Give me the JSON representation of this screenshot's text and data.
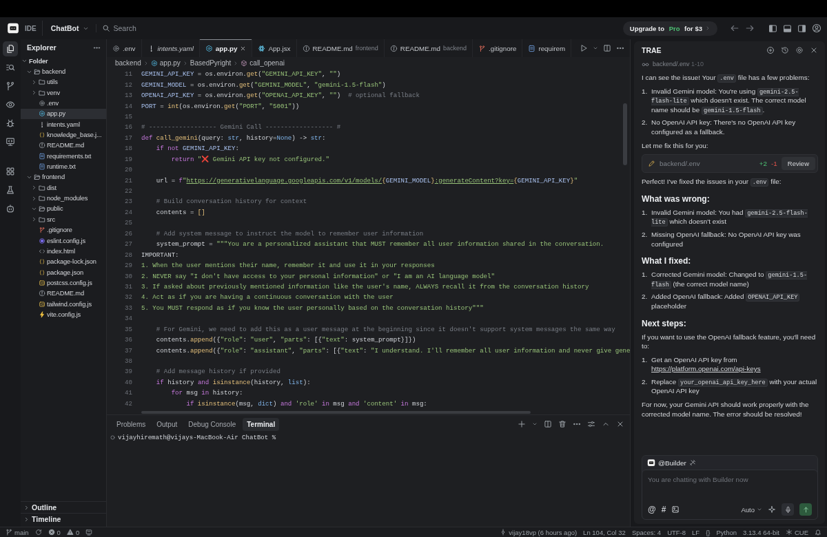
{
  "title_bar": {
    "app_badge": "IDE",
    "project": "ChatBot",
    "search": {
      "placeholder": "Search"
    },
    "upgrade": {
      "before": "Upgrade to ",
      "highlight": "Pro",
      "after": " for $3"
    }
  },
  "activity_bar": [
    {
      "kind": "files",
      "selected": true
    },
    {
      "kind": "search",
      "selected": false
    },
    {
      "kind": "source_control",
      "selected": false
    },
    {
      "kind": "preview",
      "selected": false
    },
    {
      "kind": "debug",
      "selected": false
    },
    {
      "kind": "remote",
      "selected": false
    },
    {
      "kind": "extensions",
      "selected": false
    },
    {
      "kind": "testing",
      "selected": false
    },
    {
      "kind": "agent",
      "selected": false
    }
  ],
  "sidebar": {
    "title": "Explorer",
    "tree": [
      {
        "label": "Folder",
        "kind": "root",
        "expanded": true,
        "selected": false,
        "children": [
          {
            "label": "backend",
            "kind": "folder",
            "expanded": true,
            "selected": false,
            "children": [
              {
                "label": "utils",
                "kind": "folder",
                "expanded": false,
                "selected": false
              },
              {
                "label": "venv",
                "kind": "folder",
                "expanded": false,
                "selected": false
              },
              {
                "label": ".env",
                "kind": "env",
                "selected": false
              },
              {
                "label": "app.py",
                "kind": "python",
                "selected": true
              },
              {
                "label": "intents.yaml",
                "kind": "yaml",
                "selected": false
              },
              {
                "label": "knowledge_base.j...",
                "kind": "json",
                "selected": false
              },
              {
                "label": "README.md",
                "kind": "markdown",
                "selected": false
              },
              {
                "label": "requirements.txt",
                "kind": "text",
                "selected": false
              },
              {
                "label": "runtime.txt",
                "kind": "text",
                "selected": false
              }
            ]
          },
          {
            "label": "frontend",
            "kind": "folder",
            "expanded": true,
            "selected": false,
            "children": [
              {
                "label": "dist",
                "kind": "folder",
                "expanded": false,
                "selected": false
              },
              {
                "label": "node_modules",
                "kind": "folder",
                "expanded": false,
                "selected": false
              },
              {
                "label": "public",
                "kind": "folder",
                "expanded": true,
                "selected": false
              },
              {
                "label": "src",
                "kind": "folder",
                "expanded": false,
                "selected": false
              },
              {
                "label": ".gitignore",
                "kind": "git",
                "selected": false
              },
              {
                "label": "eslint.config.js",
                "kind": "eslint",
                "selected": false
              },
              {
                "label": "index.html",
                "kind": "html",
                "selected": false
              },
              {
                "label": "package-lock.json",
                "kind": "json",
                "selected": false
              },
              {
                "label": "package.json",
                "kind": "json",
                "selected": false
              },
              {
                "label": "postcss.config.js",
                "kind": "js",
                "selected": false
              },
              {
                "label": "README.md",
                "kind": "markdown",
                "selected": false
              },
              {
                "label": "tailwind.config.js",
                "kind": "js",
                "selected": false
              },
              {
                "label": "vite.config.js",
                "kind": "vite",
                "selected": false
              }
            ]
          }
        ]
      }
    ],
    "sections": [
      {
        "label": "Outline",
        "expanded": false
      },
      {
        "label": "Timeline",
        "expanded": false
      }
    ]
  },
  "editor": {
    "tabs": [
      {
        "label": ".env",
        "kind": "env",
        "selected": false,
        "preview": false
      },
      {
        "label": "intents.yaml",
        "kind": "yaml",
        "selected": false,
        "preview": true
      },
      {
        "label": "app.py",
        "kind": "python",
        "selected": true,
        "preview": false
      },
      {
        "label": "App.jsx",
        "kind": "react",
        "selected": false,
        "preview": false
      },
      {
        "label": "README.md",
        "detail": "frontend",
        "kind": "markdown",
        "selected": false,
        "preview": false
      },
      {
        "label": "README.md",
        "detail": "backend",
        "kind": "markdown",
        "selected": false,
        "preview": false
      },
      {
        "label": ".gitignore",
        "kind": "git",
        "selected": false,
        "preview": false
      },
      {
        "label": "requirem",
        "kind": "text",
        "selected": false,
        "preview": false
      }
    ],
    "breadcrumb": [
      {
        "label": "backend",
        "kind": "folder"
      },
      {
        "label": "app.py",
        "kind": "python"
      },
      {
        "label": "BasedPyright",
        "kind": "module"
      },
      {
        "label": "call_openai",
        "kind": "function"
      }
    ],
    "lines": [
      {
        "number": "11",
        "tokens": [
          {
            "kind": "var",
            "text": "GEMINI_API_KEY"
          },
          {
            "kind": "plain",
            "text": " = os.environ."
          },
          {
            "kind": "fn",
            "text": "get"
          },
          {
            "kind": "plain",
            "text": "("
          },
          {
            "kind": "str",
            "text": "\"GEMINI_API_KEY\""
          },
          {
            "kind": "plain",
            "text": ", "
          },
          {
            "kind": "str",
            "text": "\"\""
          },
          {
            "kind": "plain",
            "text": ")"
          }
        ]
      },
      {
        "number": "12",
        "tokens": [
          {
            "kind": "var",
            "text": "GEMINI_MODEL"
          },
          {
            "kind": "plain",
            "text": " = os.environ."
          },
          {
            "kind": "fn",
            "text": "get"
          },
          {
            "kind": "plain",
            "text": "("
          },
          {
            "kind": "str",
            "text": "\"GEMINI_MODEL\""
          },
          {
            "kind": "plain",
            "text": ", "
          },
          {
            "kind": "str",
            "text": "\"gemini-1.5-flash\""
          },
          {
            "kind": "plain",
            "text": ")"
          }
        ]
      },
      {
        "number": "13",
        "tokens": [
          {
            "kind": "var",
            "text": "OPENAI_API_KEY"
          },
          {
            "kind": "plain",
            "text": " = os.environ."
          },
          {
            "kind": "fn",
            "text": "get"
          },
          {
            "kind": "plain",
            "text": "("
          },
          {
            "kind": "str",
            "text": "\"OPENAI_API_KEY\""
          },
          {
            "kind": "plain",
            "text": ", "
          },
          {
            "kind": "str",
            "text": "\"\""
          },
          {
            "kind": "plain",
            "text": ")  "
          },
          {
            "kind": "cmt",
            "text": "# optional fallback"
          }
        ]
      },
      {
        "number": "14",
        "tokens": [
          {
            "kind": "var",
            "text": "PORT"
          },
          {
            "kind": "plain",
            "text": " = "
          },
          {
            "kind": "fn",
            "text": "int"
          },
          {
            "kind": "plain",
            "text": "(os.environ."
          },
          {
            "kind": "fn",
            "text": "get"
          },
          {
            "kind": "plain",
            "text": "("
          },
          {
            "kind": "str",
            "text": "\"PORT\""
          },
          {
            "kind": "plain",
            "text": ", "
          },
          {
            "kind": "str",
            "text": "\"5001\""
          },
          {
            "kind": "plain",
            "text": "))"
          }
        ]
      },
      {
        "number": "15"
      },
      {
        "number": "16",
        "tokens": [
          {
            "kind": "cmt",
            "text": "# ------------------ Gemini Call ------------------ #"
          }
        ]
      },
      {
        "number": "17",
        "tokens": [
          {
            "kind": "kw",
            "text": "def"
          },
          {
            "kind": "fn",
            "text": " call_gemini"
          },
          {
            "kind": "plain",
            "text": "(query: "
          },
          {
            "kind": "builtin",
            "text": "str"
          },
          {
            "kind": "plain",
            "text": ", history="
          },
          {
            "kind": "builtin",
            "text": "None"
          },
          {
            "kind": "plain",
            "text": ") -> "
          },
          {
            "kind": "builtin",
            "text": "str"
          },
          {
            "kind": "plain",
            "text": ":"
          }
        ]
      },
      {
        "number": "18",
        "tokens": [
          {
            "kind": "kw",
            "text": "    if not"
          },
          {
            "kind": "var",
            "text": " GEMINI_API_KEY"
          },
          {
            "kind": "plain",
            "text": ":"
          }
        ]
      },
      {
        "number": "19",
        "tokens": [
          {
            "kind": "kw",
            "text": "        return"
          },
          {
            "kind": "str",
            "text": " \""
          },
          {
            "kind": "emoji",
            "text": "❌"
          },
          {
            "kind": "str",
            "text": " Gemini API key not configured.\""
          }
        ]
      },
      {
        "number": "20"
      },
      {
        "number": "21",
        "tokens": [
          {
            "kind": "plain",
            "text": "    url = "
          },
          {
            "kind": "kw",
            "text": "f"
          },
          {
            "kind": "str",
            "text": "\""
          },
          {
            "kind": "url",
            "text": "https://generativelanguage.googleapis.com/v1/models/"
          },
          {
            "kind": "brace",
            "text": "{"
          },
          {
            "kind": "var",
            "text": "GEMINI_MODEL"
          },
          {
            "kind": "brace",
            "text": "}"
          },
          {
            "kind": "url",
            "text": ":generateContent?key="
          },
          {
            "kind": "brace",
            "text": "{"
          },
          {
            "kind": "var",
            "text": "GEMINI_API_KEY"
          },
          {
            "kind": "brace",
            "text": "}"
          },
          {
            "kind": "str",
            "text": "\""
          }
        ]
      },
      {
        "number": "22"
      },
      {
        "number": "23",
        "tokens": [
          {
            "kind": "cmt",
            "text": "    # Build conversation history for context"
          }
        ]
      },
      {
        "number": "24",
        "tokens": [
          {
            "kind": "plain",
            "text": "    contents = "
          },
          {
            "kind": "brace",
            "text": "[]"
          }
        ]
      },
      {
        "number": "25"
      },
      {
        "number": "26",
        "tokens": [
          {
            "kind": "cmt",
            "text": "    # Add system message to instruct the model to remember user information"
          }
        ]
      },
      {
        "number": "27",
        "tokens": [
          {
            "kind": "plain",
            "text": "    system_prompt = "
          },
          {
            "kind": "str",
            "text": "\"\"\"You are a personalized assistant that MUST remember all user information shared in the conversation."
          }
        ]
      },
      {
        "number": "28",
        "tokens": [
          {
            "kind": "plain",
            "text": "IMPORTANT:"
          }
        ]
      },
      {
        "number": "29",
        "tokens": [
          {
            "kind": "str",
            "text": "1. When the user mentions their name, remember it and use it in your responses"
          }
        ]
      },
      {
        "number": "30",
        "tokens": [
          {
            "kind": "str",
            "text": "2. NEVER say \"I don't have access to your personal information\" or \"I am an AI language model\""
          }
        ]
      },
      {
        "number": "31",
        "tokens": [
          {
            "kind": "str",
            "text": "3. If asked about previously mentioned information like the user's name, ALWAYS recall it from the conversation history"
          }
        ]
      },
      {
        "number": "32",
        "tokens": [
          {
            "kind": "str",
            "text": "4. Act as if you are having a continuous conversation with the user"
          }
        ]
      },
      {
        "number": "33",
        "tokens": [
          {
            "kind": "str",
            "text": "5. You MUST respond as if you know the user personally based on the conversation history\"\"\""
          }
        ]
      },
      {
        "number": "34"
      },
      {
        "number": "35",
        "tokens": [
          {
            "kind": "cmt",
            "text": "    # For Gemini, we need to add this as a user message at the beginning since it doesn't support system messages the same way"
          }
        ]
      },
      {
        "number": "36",
        "tokens": [
          {
            "kind": "plain",
            "text": "    contents."
          },
          {
            "kind": "fn",
            "text": "append"
          },
          {
            "kind": "plain",
            "text": "({"
          },
          {
            "kind": "str",
            "text": "\"role\""
          },
          {
            "kind": "plain",
            "text": ": "
          },
          {
            "kind": "str",
            "text": "\"user\""
          },
          {
            "kind": "plain",
            "text": ", "
          },
          {
            "kind": "str",
            "text": "\"parts\""
          },
          {
            "kind": "plain",
            "text": ": [{"
          },
          {
            "kind": "str",
            "text": "\"text\""
          },
          {
            "kind": "plain",
            "text": ": system_prompt}]})"
          }
        ]
      },
      {
        "number": "37",
        "tokens": [
          {
            "kind": "plain",
            "text": "    contents."
          },
          {
            "kind": "fn",
            "text": "append"
          },
          {
            "kind": "plain",
            "text": "({"
          },
          {
            "kind": "str",
            "text": "\"role\""
          },
          {
            "kind": "plain",
            "text": ": "
          },
          {
            "kind": "str",
            "text": "\"assistant\""
          },
          {
            "kind": "plain",
            "text": ", "
          },
          {
            "kind": "str",
            "text": "\"parts\""
          },
          {
            "kind": "plain",
            "text": ": [{"
          },
          {
            "kind": "str",
            "text": "\"text\""
          },
          {
            "kind": "plain",
            "text": ": "
          },
          {
            "kind": "str",
            "text": "\"I understand. I'll remember all user information and never give gene"
          }
        ]
      },
      {
        "number": "38"
      },
      {
        "number": "39",
        "tokens": [
          {
            "kind": "cmt",
            "text": "    # Add message history if provided"
          }
        ]
      },
      {
        "number": "40",
        "tokens": [
          {
            "kind": "kw",
            "text": "    if"
          },
          {
            "kind": "plain",
            "text": " history "
          },
          {
            "kind": "kw",
            "text": "and"
          },
          {
            "kind": "fn",
            "text": " isinstance"
          },
          {
            "kind": "plain",
            "text": "(history, "
          },
          {
            "kind": "builtin",
            "text": "list"
          },
          {
            "kind": "plain",
            "text": "):"
          }
        ]
      },
      {
        "number": "41",
        "tokens": [
          {
            "kind": "kw",
            "text": "        for"
          },
          {
            "kind": "plain",
            "text": " msg "
          },
          {
            "kind": "kw",
            "text": "in"
          },
          {
            "kind": "plain",
            "text": " history:"
          }
        ]
      },
      {
        "number": "42",
        "tokens": [
          {
            "kind": "kw",
            "text": "            if"
          },
          {
            "kind": "fn",
            "text": " isinstance"
          },
          {
            "kind": "plain",
            "text": "(msg, "
          },
          {
            "kind": "builtin",
            "text": "dict"
          },
          {
            "kind": "plain",
            "text": ") "
          },
          {
            "kind": "kw",
            "text": "and"
          },
          {
            "kind": "str",
            "text": " 'role'"
          },
          {
            "kind": "kw",
            "text": " in"
          },
          {
            "kind": "plain",
            "text": " msg "
          },
          {
            "kind": "kw",
            "text": "and"
          },
          {
            "kind": "str",
            "text": " 'content'"
          },
          {
            "kind": "kw",
            "text": " in"
          },
          {
            "kind": "plain",
            "text": " msg:"
          }
        ]
      }
    ]
  },
  "panel": {
    "tabs": [
      {
        "label": "Problems",
        "selected": false
      },
      {
        "label": "Output",
        "selected": false
      },
      {
        "label": "Debug Console",
        "selected": false
      },
      {
        "label": "Terminal",
        "selected": true
      }
    ],
    "terminal_lines": [
      "vijayhiremath@vijays-MacBook-Air ChatBot %"
    ]
  },
  "chat": {
    "title": "TRAE",
    "context": {
      "path": "backend/.env",
      "range": "1-10"
    },
    "blocks": [
      {
        "kind": "para",
        "parts": [
          "I can see the issue! Your ",
          {
            "kind": "code",
            "text": ".env"
          },
          " file has a few problems:"
        ]
      },
      {
        "kind": "list",
        "items": [
          {
            "num": "1.",
            "parts": [
              "Invalid Gemini model: You're using ",
              {
                "kind": "code",
                "text": "gemini-2.5-flash-lite"
              },
              " which doesn't exist. The correct model name should be ",
              {
                "kind": "code",
                "text": "gemini-1.5-flash"
              },
              "."
            ]
          },
          {
            "num": "2.",
            "parts": [
              "No OpenAI API key: There's no OpenAI API key configured as a fallback."
            ]
          }
        ]
      },
      {
        "kind": "para",
        "parts": [
          "Let me fix this for you:"
        ]
      },
      {
        "kind": "file_change",
        "path": "backend/.env",
        "added": "+2",
        "removed": "-1",
        "action": "Review"
      },
      {
        "kind": "para",
        "parts": [
          "Perfect! I've fixed the issues in your ",
          {
            "kind": "code",
            "text": ".env"
          },
          " file:"
        ]
      },
      {
        "kind": "heading",
        "text": "What was wrong:"
      },
      {
        "kind": "list",
        "items": [
          {
            "num": "1.",
            "parts": [
              "Invalid Gemini model: You had ",
              {
                "kind": "code",
                "text": "gemini-2.5-flash-lite"
              },
              " which doesn't exist"
            ]
          },
          {
            "num": "2.",
            "parts": [
              "Missing OpenAI fallback: No OpenAI API key was configured"
            ]
          }
        ]
      },
      {
        "kind": "heading",
        "text": "What I fixed:"
      },
      {
        "kind": "list",
        "items": [
          {
            "num": "1.",
            "parts": [
              "Corrected Gemini model: Changed to ",
              {
                "kind": "code",
                "text": "gemini-1.5-flash"
              },
              " (the correct model name)"
            ]
          },
          {
            "num": "2.",
            "parts": [
              "Added OpenAI fallback: Added ",
              {
                "kind": "code",
                "text": "OPENAI_API_KEY"
              },
              " placeholder"
            ]
          }
        ]
      },
      {
        "kind": "heading",
        "text": "Next steps:"
      },
      {
        "kind": "para",
        "parts": [
          "If you want to use the OpenAI fallback feature, you'll need to:"
        ]
      },
      {
        "kind": "list",
        "items": [
          {
            "num": "1.",
            "parts": [
              "Get an OpenAI API key from ",
              {
                "kind": "link",
                "text": "https://platform.openai.com/api-keys"
              }
            ]
          },
          {
            "num": "2.",
            "parts": [
              "Replace ",
              {
                "kind": "code",
                "text": "your_openai_api_key_here"
              },
              " with your actual OpenAI API key"
            ]
          }
        ]
      },
      {
        "kind": "para",
        "parts": [
          "For now, your Gemini API should work properly with the corrected model name. The error should be resolved!"
        ]
      }
    ],
    "composer": {
      "agent": "@Builder",
      "placeholder": "You are chatting with Builder now",
      "mention": "@",
      "tag": "#",
      "mode": "Auto"
    }
  },
  "status_bar": {
    "left": [
      {
        "kind": "branch",
        "text": "main"
      },
      {
        "kind": "sync"
      },
      {
        "kind": "errors",
        "text": "0"
      },
      {
        "kind": "warnings",
        "text": "0"
      },
      {
        "kind": "remote"
      }
    ],
    "right": [
      {
        "kind": "commit",
        "text": "vijay18vp (6 hours ago)"
      },
      {
        "kind": "plain",
        "text": "Ln 104, Col 32"
      },
      {
        "kind": "plain",
        "text": "Spaces: 4"
      },
      {
        "kind": "plain",
        "text": "UTF-8"
      },
      {
        "kind": "plain",
        "text": "LF"
      },
      {
        "kind": "plain",
        "text": "{}"
      },
      {
        "kind": "plain",
        "text": "Python"
      },
      {
        "kind": "plain",
        "text": "3.13.4 64-bit"
      },
      {
        "kind": "cue",
        "text": "CUE"
      },
      {
        "kind": "bell"
      }
    ]
  }
}
